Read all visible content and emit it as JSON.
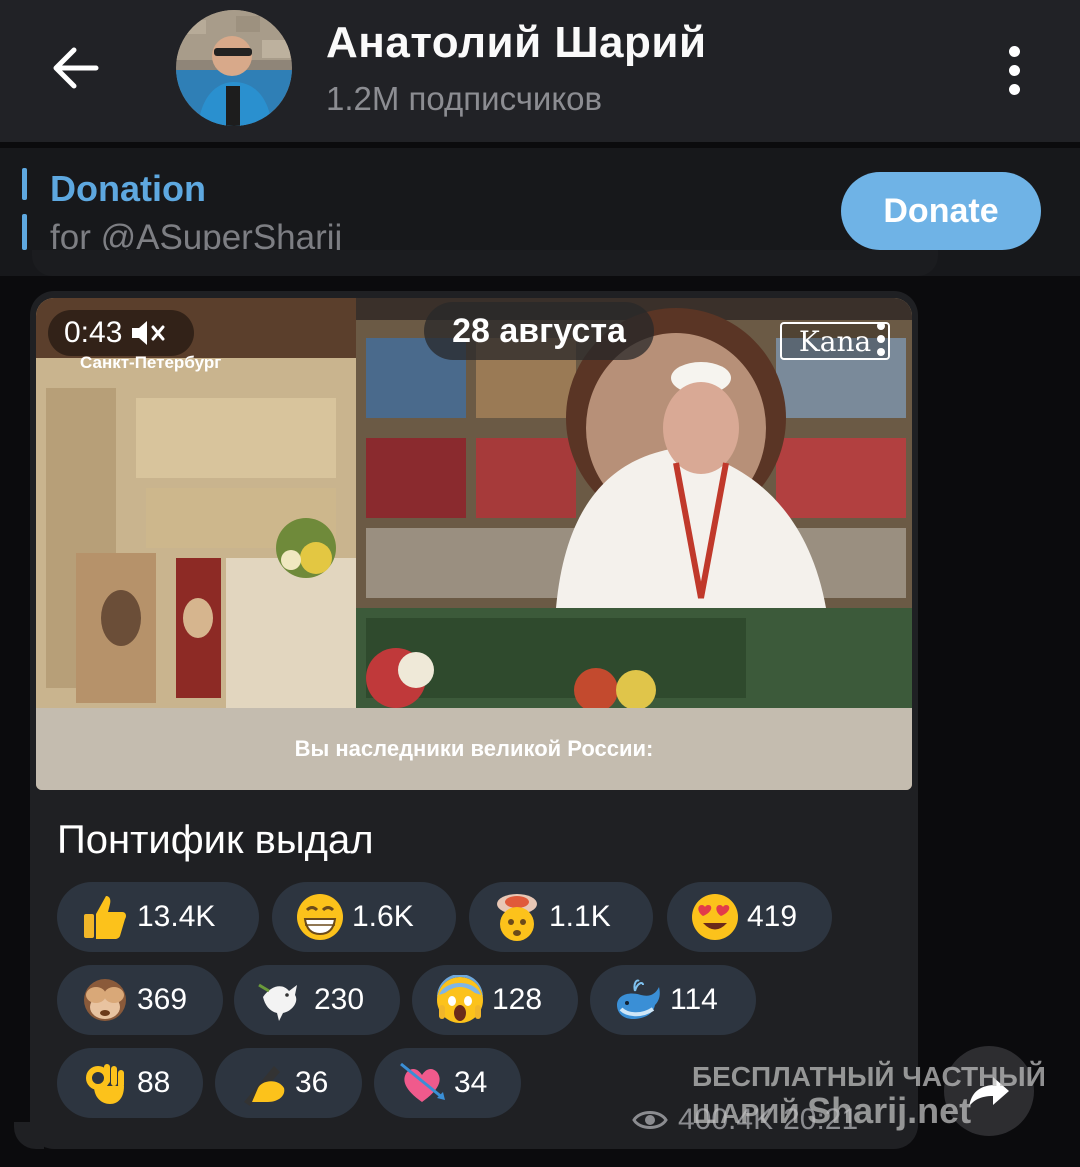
{
  "header": {
    "channel_name": "Анатолий Шарий",
    "subscribers": "1.2M подписчиков"
  },
  "pinned": {
    "title": "Donation",
    "subtitle": "for @ASuperSharij",
    "button_label": "Donate"
  },
  "video": {
    "duration": "0:43",
    "city_caption": "Санкт-Петербург",
    "date": "28 августа",
    "logo_text": "Kana",
    "subtitle": "Вы наследники великой России:"
  },
  "message": {
    "text": "Понтифик выдал"
  },
  "reactions": [
    {
      "emoji": "thumbs-up",
      "count": "13.4K"
    },
    {
      "emoji": "grin",
      "count": "1.6K"
    },
    {
      "emoji": "exploding-head",
      "count": "1.1K"
    },
    {
      "emoji": "heart-eyes",
      "count": "419"
    },
    {
      "emoji": "see-no-evil-monkey",
      "count": "369"
    },
    {
      "emoji": "dove",
      "count": "230"
    },
    {
      "emoji": "screaming-face",
      "count": "128"
    },
    {
      "emoji": "whale",
      "count": "114"
    },
    {
      "emoji": "ok-hand",
      "count": "88"
    },
    {
      "emoji": "writing-hand",
      "count": "36"
    },
    {
      "emoji": "heart-with-arrow",
      "count": "34"
    }
  ],
  "meta": {
    "views": "400.4K",
    "time": "20:21"
  },
  "watermark": {
    "line1": "БЕСПЛАТНЫЙ ЧАСТНЫЙ",
    "line2": "ШАРИЙ",
    "site": "Sharij.net"
  },
  "colors": {
    "accent": "#5ea8e0",
    "header_bg": "#212226",
    "bubble_bg": "#1f2023",
    "reaction_bg": "#2d3540"
  }
}
